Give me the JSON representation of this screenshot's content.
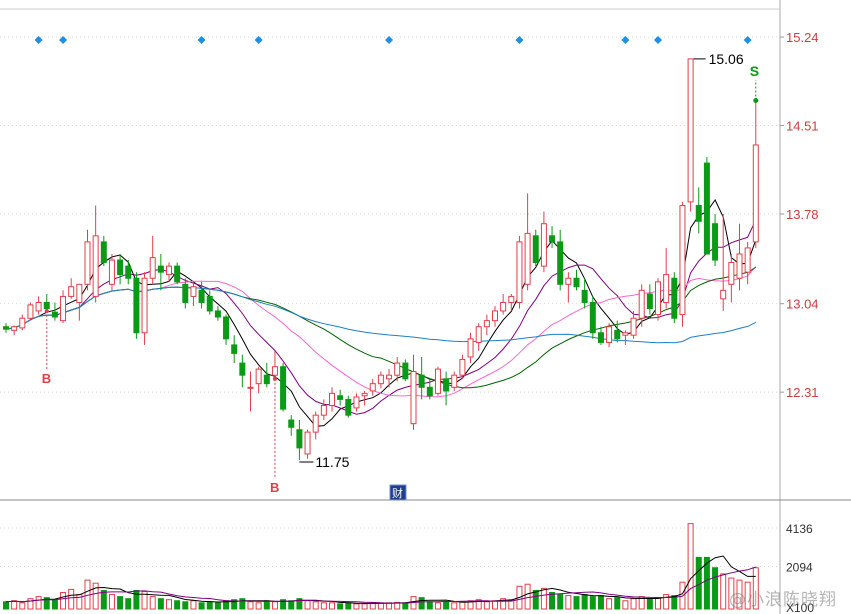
{
  "watermark": "@小浪陈晓翔",
  "colors": {
    "up": "#e0404a",
    "down": "#0a9a16",
    "ma5": "#000000",
    "ma10": "#800080",
    "ma20": "#ff66cc",
    "ma30": "#006400",
    "ma60": "#1e7fc8",
    "axis": "#d23c3c",
    "diamond": "#1e8fe6",
    "grid": "#d8d8d8"
  },
  "chart_data": [
    {
      "type": "candlestick",
      "title": "",
      "yaxis": {
        "ticks": [
          "15.24",
          "14.51",
          "13.78",
          "13.04",
          "12.31"
        ],
        "ylim": [
          11.42,
          15.48
        ]
      },
      "grid": true,
      "annotations": {
        "high_label": "15.06",
        "low_label": "11.75",
        "buy_label": "B",
        "sell_label": "S",
        "fin_badge": "财"
      },
      "candles": [
        [
          12.85,
          12.88,
          12.8,
          12.83
        ],
        [
          12.82,
          12.86,
          12.78,
          12.85
        ],
        [
          12.84,
          12.95,
          12.82,
          12.92
        ],
        [
          12.92,
          13.05,
          12.9,
          13.03
        ],
        [
          12.98,
          13.1,
          12.95,
          13.05
        ],
        [
          13.05,
          13.12,
          12.98,
          13.0
        ],
        [
          12.97,
          13.05,
          12.9,
          12.93
        ],
        [
          12.9,
          13.15,
          12.88,
          13.1
        ],
        [
          13.1,
          13.25,
          13.08,
          13.18
        ],
        [
          13.05,
          13.2,
          12.9,
          13.2
        ],
        [
          13.2,
          13.65,
          13.15,
          13.55
        ],
        [
          13.1,
          13.85,
          13.05,
          13.6
        ],
        [
          13.55,
          13.6,
          13.35,
          13.38
        ],
        [
          13.2,
          13.45,
          13.15,
          13.4
        ],
        [
          13.4,
          13.45,
          13.2,
          13.28
        ],
        [
          13.35,
          13.4,
          13.2,
          13.25
        ],
        [
          13.25,
          13.3,
          12.75,
          12.8
        ],
        [
          12.8,
          13.3,
          12.7,
          13.25
        ],
        [
          13.25,
          13.6,
          13.2,
          13.42
        ],
        [
          13.35,
          13.45,
          13.15,
          13.3
        ],
        [
          13.28,
          13.38,
          13.22,
          13.35
        ],
        [
          13.35,
          13.38,
          13.2,
          13.22
        ],
        [
          13.2,
          13.25,
          13.0,
          13.05
        ],
        [
          13.1,
          13.22,
          13.02,
          13.18
        ],
        [
          13.15,
          13.22,
          13.0,
          13.05
        ],
        [
          13.1,
          13.15,
          12.95,
          12.98
        ],
        [
          12.98,
          13.02,
          12.9,
          12.93
        ],
        [
          12.93,
          12.95,
          12.7,
          12.75
        ],
        [
          12.7,
          12.78,
          12.55,
          12.63
        ],
        [
          12.55,
          12.62,
          12.35,
          12.45
        ],
        [
          12.35,
          12.48,
          12.15,
          12.35
        ],
        [
          12.38,
          12.52,
          12.3,
          12.5
        ],
        [
          12.45,
          12.55,
          12.35,
          12.38
        ],
        [
          12.45,
          12.65,
          12.42,
          12.52
        ],
        [
          12.52,
          12.55,
          12.15,
          12.17
        ],
        [
          12.08,
          12.12,
          11.95,
          12.02
        ],
        [
          12.0,
          12.08,
          11.75,
          11.85
        ],
        [
          11.8,
          12.0,
          11.76,
          11.98
        ],
        [
          11.98,
          12.15,
          11.92,
          12.12
        ],
        [
          12.12,
          12.25,
          12.08,
          12.2
        ],
        [
          12.2,
          12.35,
          12.15,
          12.3
        ],
        [
          12.28,
          12.33,
          12.2,
          12.25
        ],
        [
          12.25,
          12.28,
          12.1,
          12.12
        ],
        [
          12.18,
          12.3,
          12.15,
          12.27
        ],
        [
          12.28,
          12.32,
          12.2,
          12.3
        ],
        [
          12.32,
          12.42,
          12.28,
          12.38
        ],
        [
          12.38,
          12.48,
          12.34,
          12.45
        ],
        [
          12.42,
          12.5,
          12.35,
          12.45
        ],
        [
          12.45,
          12.6,
          12.4,
          12.55
        ],
        [
          12.55,
          12.58,
          12.4,
          12.42
        ],
        [
          12.05,
          12.62,
          12.0,
          12.48
        ],
        [
          12.45,
          12.6,
          12.25,
          12.35
        ],
        [
          12.35,
          12.42,
          12.25,
          12.28
        ],
        [
          12.3,
          12.52,
          12.28,
          12.5
        ],
        [
          12.42,
          12.48,
          12.2,
          12.32
        ],
        [
          12.35,
          12.48,
          12.32,
          12.45
        ],
        [
          12.45,
          12.62,
          12.42,
          12.58
        ],
        [
          12.6,
          12.8,
          12.55,
          12.75
        ],
        [
          12.72,
          12.88,
          12.65,
          12.85
        ],
        [
          12.85,
          12.95,
          12.78,
          12.9
        ],
        [
          12.9,
          13.02,
          12.85,
          12.98
        ],
        [
          12.98,
          13.12,
          12.95,
          13.05
        ],
        [
          13.05,
          13.12,
          12.98,
          13.1
        ],
        [
          13.05,
          13.6,
          13.0,
          13.55
        ],
        [
          13.2,
          13.95,
          13.15,
          13.62
        ],
        [
          13.6,
          13.65,
          13.35,
          13.38
        ],
        [
          13.35,
          13.8,
          13.3,
          13.7
        ],
        [
          13.6,
          13.68,
          13.5,
          13.55
        ],
        [
          13.55,
          13.65,
          13.15,
          13.2
        ],
        [
          13.2,
          13.3,
          13.05,
          13.25
        ],
        [
          13.25,
          13.32,
          13.15,
          13.18
        ],
        [
          13.15,
          13.25,
          13.0,
          13.05
        ],
        [
          13.05,
          13.1,
          12.75,
          12.8
        ],
        [
          12.8,
          12.85,
          12.7,
          12.72
        ],
        [
          12.72,
          12.88,
          12.68,
          12.85
        ],
        [
          12.82,
          12.9,
          12.72,
          12.75
        ],
        [
          12.78,
          12.82,
          12.7,
          12.8
        ],
        [
          12.78,
          12.98,
          12.75,
          12.92
        ],
        [
          12.92,
          13.2,
          12.85,
          13.15
        ],
        [
          13.12,
          13.2,
          12.95,
          13.0
        ],
        [
          12.95,
          13.25,
          12.9,
          13.22
        ],
        [
          13.05,
          13.5,
          13.0,
          13.28
        ],
        [
          13.25,
          13.3,
          12.88,
          12.92
        ],
        [
          12.95,
          13.88,
          12.85,
          13.85
        ],
        [
          13.88,
          15.06,
          13.8,
          15.06
        ],
        [
          13.85,
          14.0,
          13.62,
          13.72
        ],
        [
          14.2,
          14.25,
          13.5,
          13.45
        ],
        [
          13.7,
          13.78,
          13.35,
          13.4
        ],
        [
          13.08,
          13.78,
          12.98,
          13.15
        ],
        [
          13.2,
          13.45,
          13.05,
          13.38
        ],
        [
          13.25,
          13.7,
          13.15,
          13.45
        ],
        [
          13.3,
          13.55,
          13.2,
          13.5
        ],
        [
          13.55,
          14.7,
          13.5,
          14.35
        ]
      ]
    },
    {
      "type": "bar",
      "title": "",
      "yaxis": {
        "ticks": [
          "4136",
          "2094",
          "X100"
        ],
        "ylim": [
          0,
          4700
        ]
      },
      "values": [
        350,
        400,
        300,
        500,
        600,
        550,
        450,
        800,
        950,
        700,
        1400,
        1250,
        900,
        700,
        600,
        500,
        900,
        850,
        600,
        500,
        450,
        400,
        350,
        400,
        300,
        350,
        300,
        400,
        450,
        500,
        350,
        300,
        400,
        350,
        450,
        400,
        500,
        400,
        350,
        300,
        300,
        250,
        300,
        250,
        250,
        300,
        280,
        300,
        320,
        300,
        600,
        550,
        350,
        300,
        350,
        300,
        350,
        400,
        450,
        350,
        400,
        500,
        450,
        1100,
        1200,
        900,
        1000,
        800,
        700,
        650,
        600,
        700,
        600,
        650,
        500,
        550,
        400,
        500,
        600,
        500,
        550,
        700,
        650,
        1300,
        4136,
        2500,
        2500,
        2000,
        1700,
        1500,
        1400,
        1300,
        2000
      ]
    }
  ]
}
